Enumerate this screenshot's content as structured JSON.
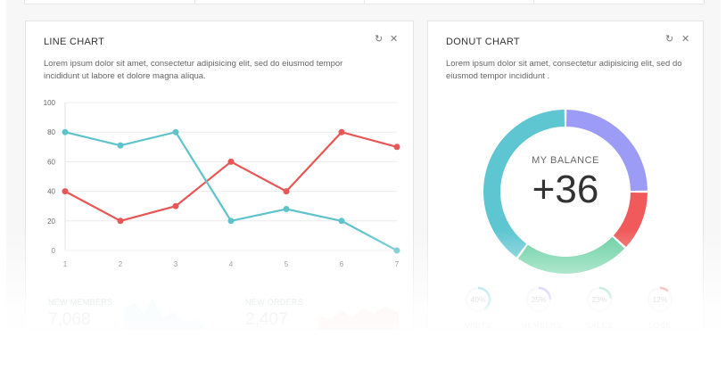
{
  "line_card": {
    "title": "LINE CHART",
    "description_1": "Lorem ipsum dolor sit amet, consectetur adipisicing elit, sed do eiusmod tempor",
    "description_2": "incididunt ut labore et dolore magna aliqua.",
    "refresh_icon": "refresh-icon",
    "close_icon": "close-icon"
  },
  "donut_card": {
    "title": "DONUT CHART",
    "description_1": "Lorem ipsum dolor sit amet, consectetur adipisicing elit, sed do",
    "description_2": "eiusmod tempor incididunt .",
    "center_label": "MY BALANCE",
    "center_value": "+36",
    "mini_stats": [
      {
        "value": "40%",
        "label": "VISITS",
        "percent": 40,
        "color": "#5ec6d1"
      },
      {
        "value": "25%",
        "label": "MEMBERS",
        "percent": 25,
        "color": "#9c9cf7"
      },
      {
        "value": "23%",
        "label": "SALES",
        "percent": 23,
        "color": "#66cfa0"
      },
      {
        "value": "12%",
        "label": "LOSE",
        "percent": 12,
        "color": "#f05a5a"
      }
    ]
  },
  "bottom_stats": {
    "new_members_label": "NEW MEMBERS",
    "new_members_value": "7,068",
    "new_orders_label": "NEW ORDERS",
    "new_orders_value": "2,407"
  },
  "chart_data": [
    {
      "type": "line",
      "x": [
        1,
        2,
        3,
        4,
        5,
        6,
        7
      ],
      "series": [
        {
          "values": [
            40,
            20,
            30,
            60,
            40,
            80,
            70
          ],
          "color": "#e85656"
        },
        {
          "values": [
            80,
            71,
            80,
            20,
            28,
            20,
            0
          ],
          "color": "#5ec3ca"
        }
      ],
      "ylim": [
        0,
        100
      ],
      "yticks": [
        0,
        20,
        40,
        60,
        80,
        100
      ],
      "grid": true
    },
    {
      "type": "pie",
      "donut": true,
      "slices": [
        {
          "value": 25,
          "color": "#9c9cf7"
        },
        {
          "value": 12,
          "color": "#f05a5a"
        },
        {
          "value": 23,
          "color": "#66cfa0"
        },
        {
          "value": 40,
          "color": "#5ec6d1"
        }
      ]
    }
  ]
}
